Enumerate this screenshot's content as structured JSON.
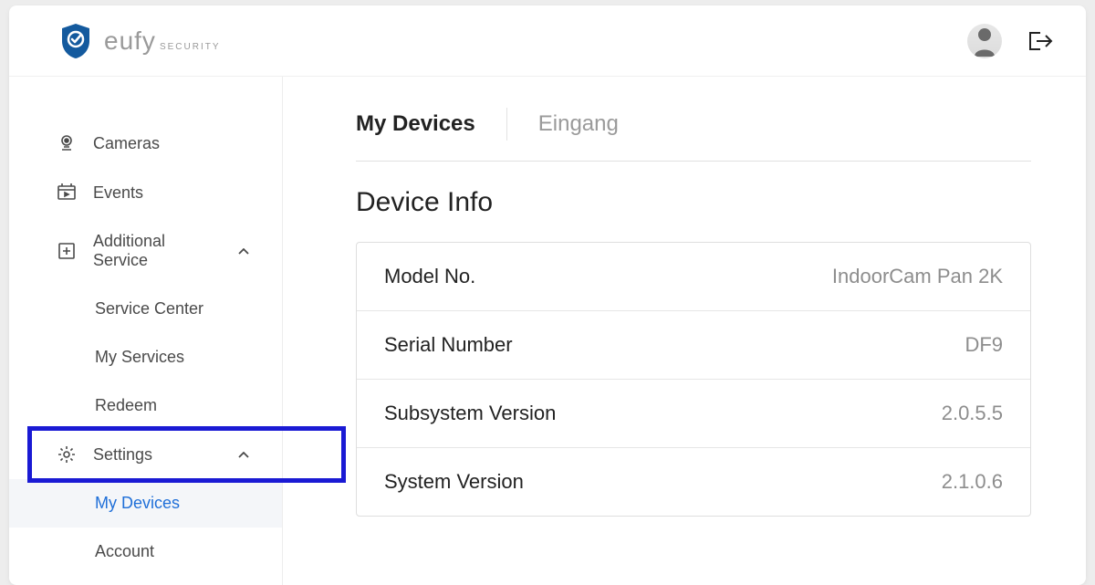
{
  "brand": {
    "name": "eufy",
    "sub": "SECURITY"
  },
  "sidebar": {
    "items": [
      {
        "label": "Cameras"
      },
      {
        "label": "Events"
      },
      {
        "label": "Additional Service",
        "expandable": true
      }
    ],
    "additional_sub": [
      {
        "label": "Service Center"
      },
      {
        "label": "My Services"
      },
      {
        "label": "Redeem"
      }
    ],
    "settings": {
      "label": "Settings"
    },
    "settings_sub": [
      {
        "label": "My Devices",
        "active": true
      },
      {
        "label": "Account"
      }
    ]
  },
  "tabs": [
    {
      "label": "My Devices",
      "active": true
    },
    {
      "label": "Eingang"
    }
  ],
  "section_title": "Device Info",
  "device_info": [
    {
      "label": "Model No.",
      "value": "IndoorCam Pan 2K"
    },
    {
      "label": "Serial Number",
      "value": "DF9"
    },
    {
      "label": "Subsystem Version",
      "value": "2.0.5.5"
    },
    {
      "label": "System Version",
      "value": "2.1.0.6"
    }
  ]
}
